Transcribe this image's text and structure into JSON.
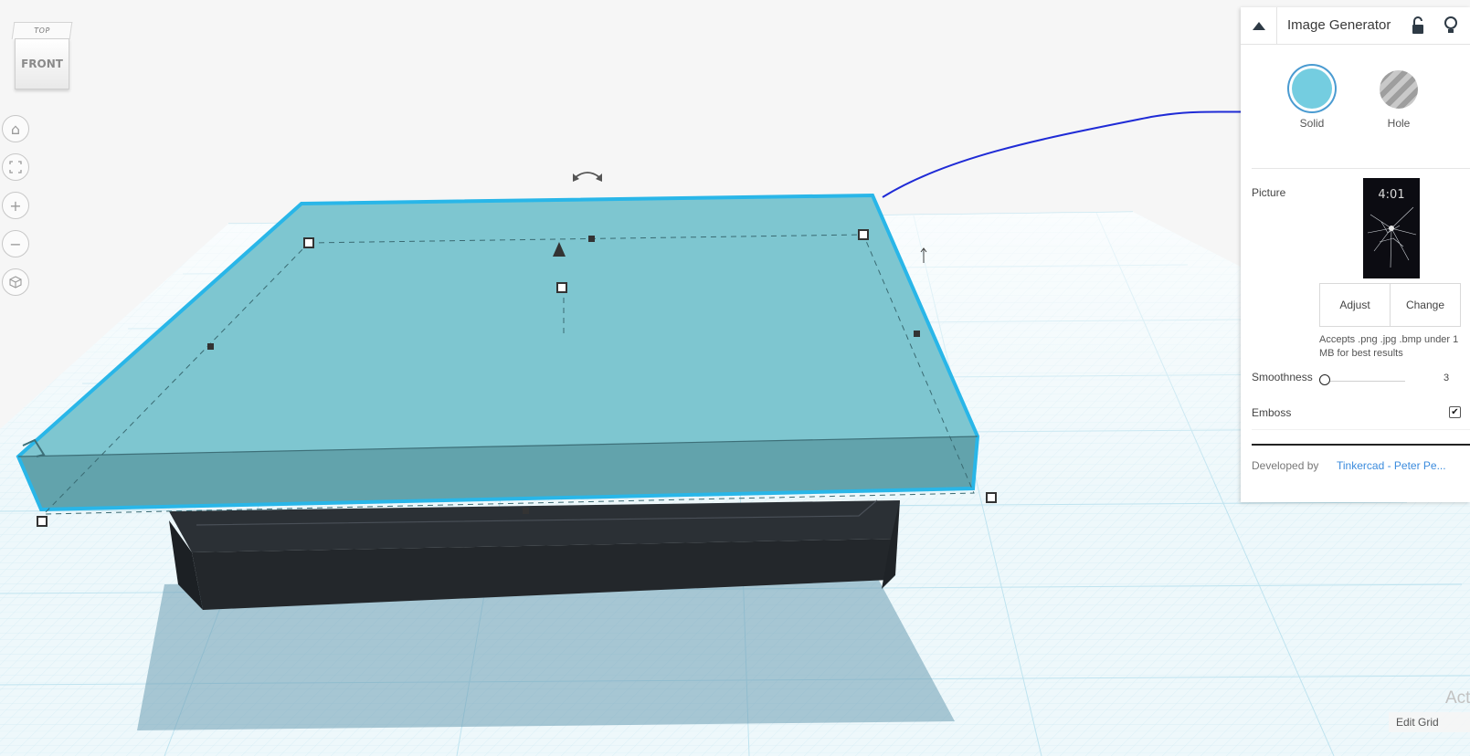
{
  "view_cube": {
    "top_label": "TOP",
    "front_label": "FRONT"
  },
  "nav_controls": [
    {
      "name": "home-view-button",
      "icon": "home-icon"
    },
    {
      "name": "fit-view-button",
      "icon": "fit-icon"
    },
    {
      "name": "zoom-in-button",
      "icon": "plus-icon"
    },
    {
      "name": "zoom-out-button",
      "icon": "minus-icon"
    },
    {
      "name": "perspective-button",
      "icon": "cube-icon"
    }
  ],
  "inspector": {
    "title": "Image Generator",
    "solid_label": "Solid",
    "hole_label": "Hole",
    "picture_label": "Picture",
    "thumbnail_time": "4:01",
    "adjust_label": "Adjust",
    "change_label": "Change",
    "hint": "Accepts .png .jpg .bmp under 1 MB for best results",
    "smoothness_label": "Smoothness",
    "smoothness_value": "3",
    "emboss_label": "Emboss",
    "emboss_checked": true,
    "developed_by_label": "Developed by",
    "developer_link": "Tinkercad - Peter Pe..."
  },
  "colors": {
    "solid": "#7ccfdf",
    "selection": "#29b6e8",
    "grid": "#bfe6f2",
    "base_block": "#23272b",
    "annotation": "#1f2bd6"
  },
  "edit_grid_label": "Edit Grid",
  "watermark": "Act"
}
